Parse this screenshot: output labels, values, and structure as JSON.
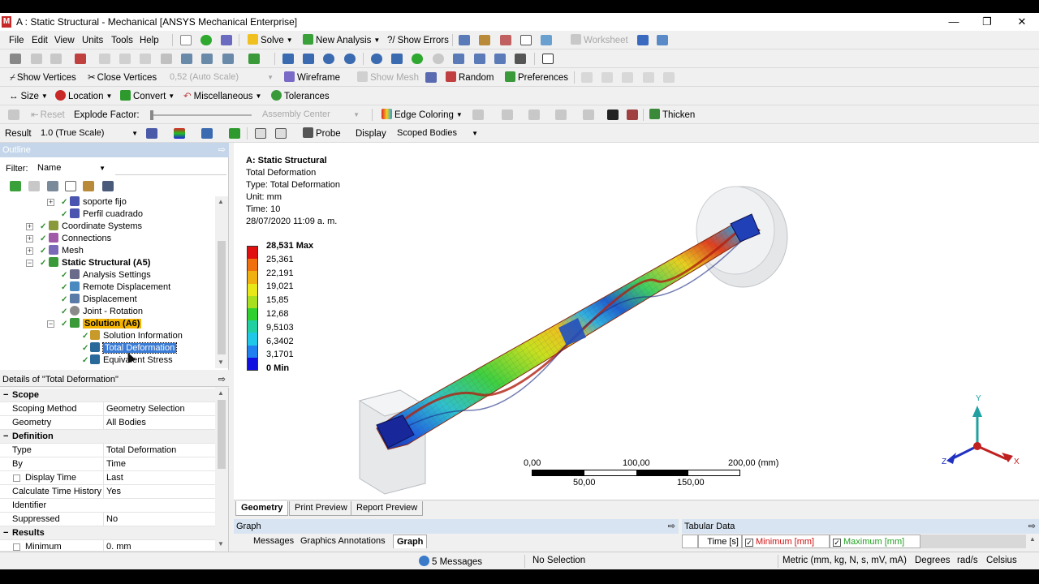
{
  "window": {
    "title": "A : Static Structural - Mechanical [ANSYS Mechanical Enterprise]",
    "logo": "M",
    "minimize": "—",
    "restore": "❐",
    "close": "✕"
  },
  "menu": [
    "File",
    "Edit",
    "View",
    "Units",
    "Tools",
    "Help"
  ],
  "toolbar1": {
    "solve": "Solve",
    "new_analysis": "New Analysis",
    "show_errors": "Show Errors",
    "worksheet": "Worksheet"
  },
  "toolbar3": {
    "show_vertices": "Show Vertices",
    "close_vertices": "Close Vertices",
    "scale": "0,52 (Auto Scale)",
    "wireframe": "Wireframe",
    "show_mesh": "Show Mesh",
    "random": "Random",
    "preferences": "Preferences"
  },
  "toolbar4": {
    "size": "Size",
    "location": "Location",
    "convert": "Convert",
    "miscellaneous": "Miscellaneous",
    "tolerances": "Tolerances"
  },
  "toolbar5": {
    "reset": "Reset",
    "explode_factor": "Explode Factor:",
    "assembly_center": "Assembly Center",
    "edge_coloring": "Edge Coloring",
    "thicken": "Thicken"
  },
  "toolbar6": {
    "result": "Result",
    "result_scale": "1.0 (True Scale)",
    "probe": "Probe",
    "display": "Display",
    "scoped_bodies": "Scoped Bodies"
  },
  "outline": {
    "header": "Outline",
    "pin": "⇨",
    "filter_label": "Filter:",
    "filter_value": "Name",
    "tree": [
      {
        "label": "soporte fijo",
        "color": "#4a55b0"
      },
      {
        "label": "Perfil cuadrado",
        "color": "#4a55b0"
      },
      {
        "label": "Coordinate Systems",
        "color": "#8a9a3a"
      },
      {
        "label": "Connections",
        "color": "#a05aa8"
      },
      {
        "label": "Mesh",
        "color": "#7a6ab8"
      },
      {
        "label": "Static Structural (A5)",
        "color": "#3a9a3a"
      },
      {
        "label": "Analysis Settings",
        "color": "#6a6a8a"
      },
      {
        "label": "Remote Displacement",
        "color": "#4a8ac0"
      },
      {
        "label": "Displacement",
        "color": "#5a7aa8"
      },
      {
        "label": "Joint - Rotation",
        "color": "#8a8a8a"
      },
      {
        "label": "Solution (A6)",
        "color": "#3a9a3a"
      },
      {
        "label": "Solution Information",
        "color": "#c89a2a"
      },
      {
        "label": "Total Deformation",
        "color": "#2a6a9a"
      },
      {
        "label": "Equivalent Stress",
        "color": "#2a6a9a"
      }
    ]
  },
  "details": {
    "header": "Details of \"Total Deformation\"",
    "pin": "⇨",
    "sections": {
      "scope": "Scope",
      "definition": "Definition",
      "results": "Results"
    },
    "rows": {
      "scoping_method_k": "Scoping Method",
      "scoping_method_v": "Geometry Selection",
      "geometry_k": "Geometry",
      "geometry_v": "All Bodies",
      "type_k": "Type",
      "type_v": "Total Deformation",
      "by_k": "By",
      "by_v": "Time",
      "display_time_k": "Display Time",
      "display_time_v": "Last",
      "calc_hist_k": "Calculate Time History",
      "calc_hist_v": "Yes",
      "identifier_k": "Identifier",
      "identifier_v": "",
      "suppressed_k": "Suppressed",
      "suppressed_v": "No",
      "minimum_k": "Minimum",
      "minimum_v": "0. mm"
    }
  },
  "viewport": {
    "analysis": "A: Static Structural",
    "result": "Total Deformation",
    "type": "Type: Total Deformation",
    "unit": "Unit: mm",
    "time": "Time: 10",
    "date": "28/07/2020 11:09 a. m.",
    "legend": [
      "28,531 Max",
      "25,361",
      "22,191",
      "19,021",
      "15,85",
      "12,68",
      "9,5103",
      "6,3402",
      "3,1701",
      "0 Min"
    ],
    "legend_colors": [
      "#e01010",
      "#f07010",
      "#f0b010",
      "#e8e818",
      "#a8e020",
      "#30d030",
      "#20d0a0",
      "#20c8e8",
      "#2080f0",
      "#1010e0"
    ],
    "scale_top": [
      "0,00",
      "100,00",
      "200,00 (mm)"
    ],
    "scale_bottom": [
      "50,00",
      "150,00"
    ],
    "axis": {
      "x": "X",
      "y": "Y",
      "z": "Z"
    }
  },
  "tabs": [
    "Geometry",
    "Print Preview",
    "Report Preview"
  ],
  "graph": {
    "header": "Graph",
    "pin": "⇨",
    "tabs": [
      "Messages",
      "Graphics Annotations",
      "Graph"
    ]
  },
  "tabular": {
    "header": "Tabular Data",
    "pin": "⇨",
    "cols": [
      "Time [s]",
      "Minimum [mm]",
      "Maximum [mm]"
    ],
    "col_colors": [
      "#000000",
      "#d01010",
      "#20a020"
    ]
  },
  "status": {
    "messages": "5 Messages",
    "selection": "No Selection",
    "units": "Metric (mm, kg, N, s, mV, mA)",
    "degrees": "Degrees",
    "rads": "rad/s",
    "celsius": "Celsius"
  }
}
